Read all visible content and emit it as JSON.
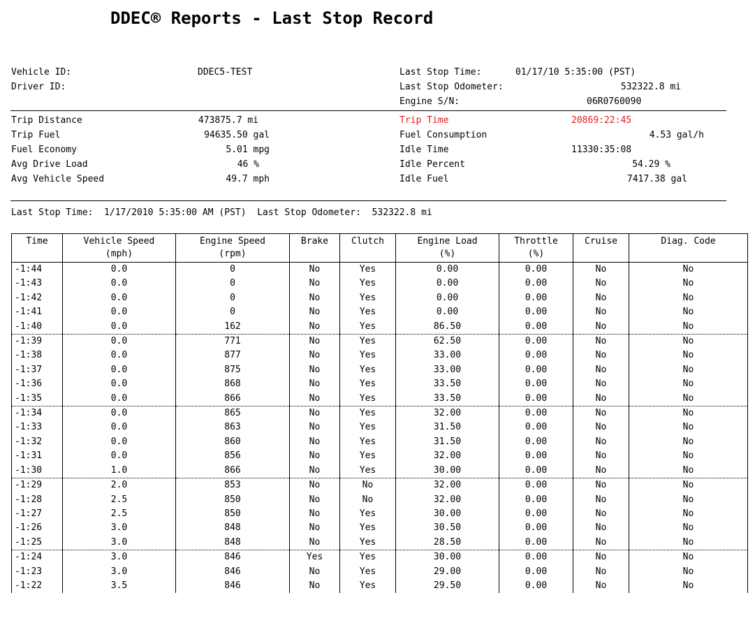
{
  "title": "DDEC® Reports - Last Stop Record",
  "header": {
    "vehicle_id_label": "Vehicle ID:",
    "vehicle_id": "DDEC5-TEST",
    "driver_id_label": "Driver ID:",
    "last_stop_time_label": "Last Stop Time:",
    "last_stop_time": "01/17/10 5:35:00 (PST)",
    "last_stop_odometer_label": "Last Stop Odometer:",
    "last_stop_odometer": "532322.8 mi",
    "engine_sn_label": "Engine S/N:",
    "engine_sn": "06R0760090"
  },
  "summary_left": [
    {
      "label": "Trip Distance",
      "value": "473875.7 mi"
    },
    {
      "label": "Trip Fuel",
      "value": "94635.50 gal"
    },
    {
      "label": "Fuel Economy",
      "value": "5.01 mpg"
    },
    {
      "label": "Avg Drive Load",
      "value": "46 %"
    },
    {
      "label": "Avg Vehicle Speed",
      "value": "49.7 mph"
    }
  ],
  "summary_right": [
    {
      "label": "Trip Time",
      "value": "20869:22:45"
    },
    {
      "label": "Fuel Consumption",
      "value": "4.53 gal/h"
    },
    {
      "label": "Idle Time",
      "value": "11330:35:08"
    },
    {
      "label": "Idle Percent",
      "value": "54.29 %"
    },
    {
      "label": "Idle Fuel",
      "value": "7417.38 gal"
    }
  ],
  "highlight_color": "#e02020",
  "stop_line": "Last Stop Time:  1/17/2010 5:35:00 AM (PST)  Last Stop Odometer:  532322.8 mi",
  "table": {
    "columns": [
      {
        "line1": "Time",
        "line2": ""
      },
      {
        "line1": "Vehicle Speed",
        "line2": "(mph)"
      },
      {
        "line1": "Engine Speed",
        "line2": "(rpm)"
      },
      {
        "line1": "Brake",
        "line2": ""
      },
      {
        "line1": "Clutch",
        "line2": ""
      },
      {
        "line1": "Engine Load",
        "line2": "(%)"
      },
      {
        "line1": "Throttle",
        "line2": "(%)"
      },
      {
        "line1": "Cruise",
        "line2": ""
      },
      {
        "line1": "Diag. Code",
        "line2": ""
      }
    ],
    "rows": [
      [
        "-1:44",
        "0.0",
        "0",
        "No",
        "Yes",
        "0.00",
        "0.00",
        "No",
        "No"
      ],
      [
        "-1:43",
        "0.0",
        "0",
        "No",
        "Yes",
        "0.00",
        "0.00",
        "No",
        "No"
      ],
      [
        "-1:42",
        "0.0",
        "0",
        "No",
        "Yes",
        "0.00",
        "0.00",
        "No",
        "No"
      ],
      [
        "-1:41",
        "0.0",
        "0",
        "No",
        "Yes",
        "0.00",
        "0.00",
        "No",
        "No"
      ],
      [
        "-1:40",
        "0.0",
        "162",
        "No",
        "Yes",
        "86.50",
        "0.00",
        "No",
        "No"
      ],
      [
        "-1:39",
        "0.0",
        "771",
        "No",
        "Yes",
        "62.50",
        "0.00",
        "No",
        "No"
      ],
      [
        "-1:38",
        "0.0",
        "877",
        "No",
        "Yes",
        "33.00",
        "0.00",
        "No",
        "No"
      ],
      [
        "-1:37",
        "0.0",
        "875",
        "No",
        "Yes",
        "33.00",
        "0.00",
        "No",
        "No"
      ],
      [
        "-1:36",
        "0.0",
        "868",
        "No",
        "Yes",
        "33.50",
        "0.00",
        "No",
        "No"
      ],
      [
        "-1:35",
        "0.0",
        "866",
        "No",
        "Yes",
        "33.50",
        "0.00",
        "No",
        "No"
      ],
      [
        "-1:34",
        "0.0",
        "865",
        "No",
        "Yes",
        "32.00",
        "0.00",
        "No",
        "No"
      ],
      [
        "-1:33",
        "0.0",
        "863",
        "No",
        "Yes",
        "31.50",
        "0.00",
        "No",
        "No"
      ],
      [
        "-1:32",
        "0.0",
        "860",
        "No",
        "Yes",
        "31.50",
        "0.00",
        "No",
        "No"
      ],
      [
        "-1:31",
        "0.0",
        "856",
        "No",
        "Yes",
        "32.00",
        "0.00",
        "No",
        "No"
      ],
      [
        "-1:30",
        "1.0",
        "866",
        "No",
        "Yes",
        "30.00",
        "0.00",
        "No",
        "No"
      ],
      [
        "-1:29",
        "2.0",
        "853",
        "No",
        "No",
        "32.00",
        "0.00",
        "No",
        "No"
      ],
      [
        "-1:28",
        "2.5",
        "850",
        "No",
        "No",
        "32.00",
        "0.00",
        "No",
        "No"
      ],
      [
        "-1:27",
        "2.5",
        "850",
        "No",
        "Yes",
        "30.00",
        "0.00",
        "No",
        "No"
      ],
      [
        "-1:26",
        "3.0",
        "848",
        "No",
        "Yes",
        "30.50",
        "0.00",
        "No",
        "No"
      ],
      [
        "-1:25",
        "3.0",
        "848",
        "No",
        "Yes",
        "28.50",
        "0.00",
        "No",
        "No"
      ],
      [
        "-1:24",
        "3.0",
        "846",
        "Yes",
        "Yes",
        "30.00",
        "0.00",
        "No",
        "No"
      ],
      [
        "-1:23",
        "3.0",
        "846",
        "No",
        "Yes",
        "29.00",
        "0.00",
        "No",
        "No"
      ],
      [
        "-1:22",
        "3.5",
        "846",
        "No",
        "Yes",
        "29.50",
        "0.00",
        "No",
        "No"
      ]
    ]
  }
}
